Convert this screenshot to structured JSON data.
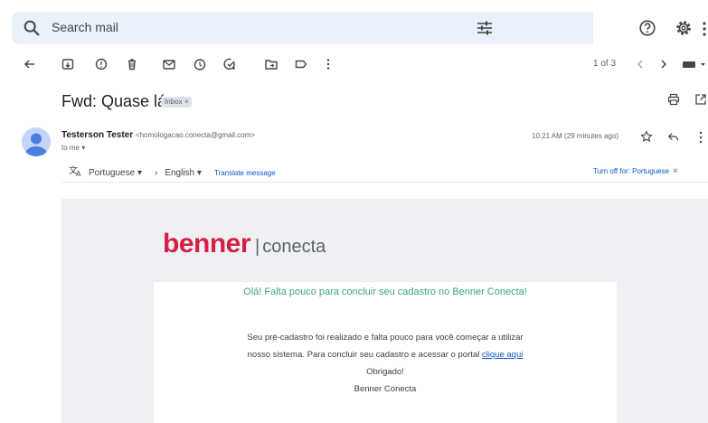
{
  "search": {
    "placeholder": "Search mail"
  },
  "toolbar": {
    "pager": "1 of 3"
  },
  "message": {
    "subject": "Fwd: Quase lá",
    "label": "Inbox",
    "label_close": "×",
    "sender_name": "Testerson Tester",
    "sender_email": "<homologacao.conecta@gmail.com>",
    "to": "to me ▾",
    "timestamp": "10:21 AM (29 minutes ago)"
  },
  "translate": {
    "from_lang": "Portuguese",
    "to_lang": "English",
    "link": "Translate message",
    "turn_off": "Turn off for: Portuguese",
    "close": "×"
  },
  "email": {
    "logo_brand": "benner",
    "logo_separator": "|",
    "logo_product": "conecta",
    "greeting": "Olá! Falta pouco para concluir seu cadastro no Benner Conecta!",
    "body_line1": "Seu pré-cadastro foi realizado e falta pouco para você começar a utilizar",
    "body_line2": "nosso sistema. Para concluir seu cadastro e acessar o portal",
    "link_text": "clique aqui",
    "thanks": "Obrigado!",
    "signature": "Benner Conecta"
  },
  "colors": {
    "brand_red": "#d61f45",
    "greeting_teal": "#3aa38e",
    "link_blue": "#0b57d0"
  }
}
